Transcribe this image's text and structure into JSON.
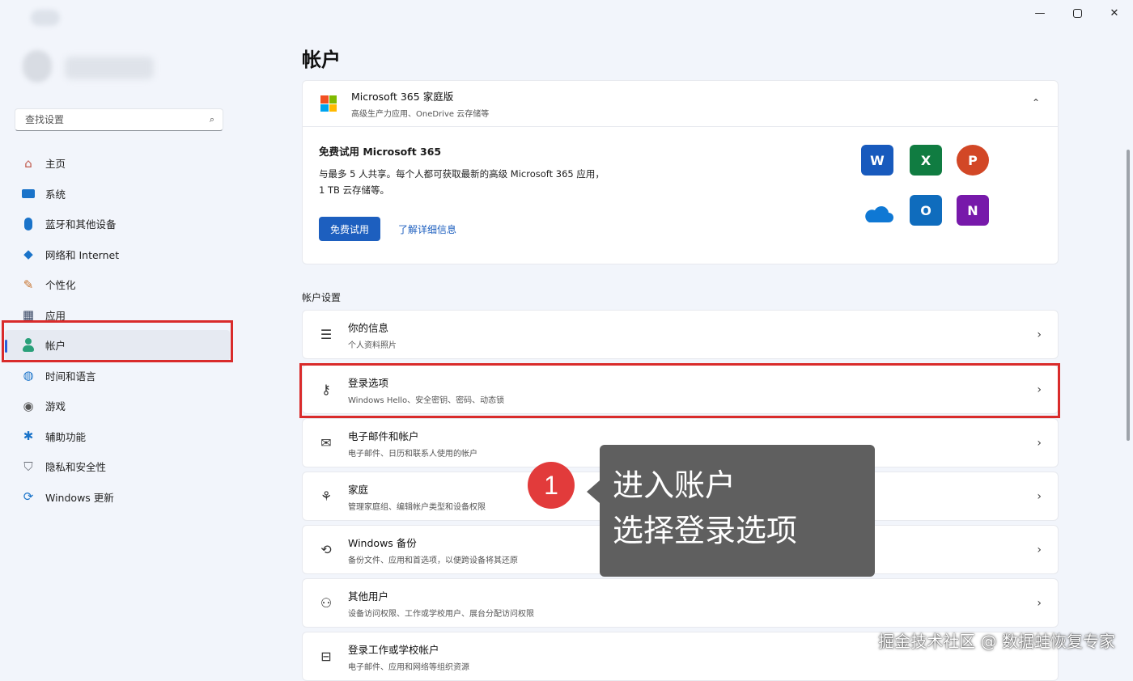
{
  "sidebar": {
    "search_placeholder": "查找设置",
    "nav": [
      {
        "label": "主页",
        "icon": "home-icon",
        "active": false
      },
      {
        "label": "系统",
        "icon": "monitor-icon",
        "active": false
      },
      {
        "label": "蓝牙和其他设备",
        "icon": "bluetooth-icon",
        "active": false
      },
      {
        "label": "网络和 Internet",
        "icon": "wifi-icon",
        "active": false
      },
      {
        "label": "个性化",
        "icon": "brush-icon",
        "active": false
      },
      {
        "label": "应用",
        "icon": "apps-icon",
        "active": false
      },
      {
        "label": "帐户",
        "icon": "person-icon",
        "active": true
      },
      {
        "label": "时间和语言",
        "icon": "globe-icon",
        "active": false
      },
      {
        "label": "游戏",
        "icon": "gamepad-icon",
        "active": false
      },
      {
        "label": "辅助功能",
        "icon": "accessibility-icon",
        "active": false
      },
      {
        "label": "隐私和安全性",
        "icon": "shield-icon",
        "active": false
      },
      {
        "label": "Windows 更新",
        "icon": "update-icon",
        "active": false
      }
    ]
  },
  "main": {
    "title": "帐户",
    "m365": {
      "title": "Microsoft 365 家庭版",
      "subtitle": "高级生产力应用、OneDrive 云存储等",
      "promo_title": "免费试用 Microsoft 365",
      "promo_desc": "与最多 5 人共享。每个人都可获取最新的高级 Microsoft 365 应用，1 TB 云存储等。",
      "trial_button": "免费试用",
      "learn_more": "了解详细信息",
      "apps": [
        {
          "name": "word-icon",
          "letter": "W",
          "color": "#185abd"
        },
        {
          "name": "excel-icon",
          "letter": "X",
          "color": "#107c41"
        },
        {
          "name": "powerpoint-icon",
          "letter": "P",
          "color": "#d24726"
        },
        {
          "name": "onedrive-icon",
          "letter": "",
          "color": "#0f78d4"
        },
        {
          "name": "outlook-icon",
          "letter": "O",
          "color": "#0f6cbd"
        },
        {
          "name": "onenote-icon",
          "letter": "N",
          "color": "#7719aa"
        }
      ]
    },
    "section_label": "帐户设置",
    "rows": [
      {
        "title": "你的信息",
        "subtitle": "个人资料照片",
        "icon": "person-info-icon"
      },
      {
        "title": "登录选项",
        "subtitle": "Windows Hello、安全密钥、密码、动态锁",
        "icon": "key-icon"
      },
      {
        "title": "电子邮件和帐户",
        "subtitle": "电子邮件、日历和联系人使用的帐户",
        "icon": "mail-icon"
      },
      {
        "title": "家庭",
        "subtitle": "管理家庭组、编辑帐户类型和设备权限",
        "icon": "family-icon"
      },
      {
        "title": "Windows 备份",
        "subtitle": "备份文件、应用和首选项，以便跨设备将其还原",
        "icon": "sync-icon"
      },
      {
        "title": "其他用户",
        "subtitle": "设备访问权限、工作或学校用户、展台分配访问权限",
        "icon": "add-user-icon"
      },
      {
        "title": "登录工作或学校帐户",
        "subtitle": "电子邮件、应用和网络等组织资源",
        "icon": "briefcase-icon"
      }
    ]
  },
  "callout": {
    "number": "1",
    "line1": "进入账户",
    "line2": "选择登录选项"
  },
  "watermark": "掘金技术社区 @ 数据蛙恢复专家",
  "colors": {
    "accent": "#1d5fbf",
    "highlight": "#d92b2b",
    "callout_bg": "#5f5f5f"
  }
}
